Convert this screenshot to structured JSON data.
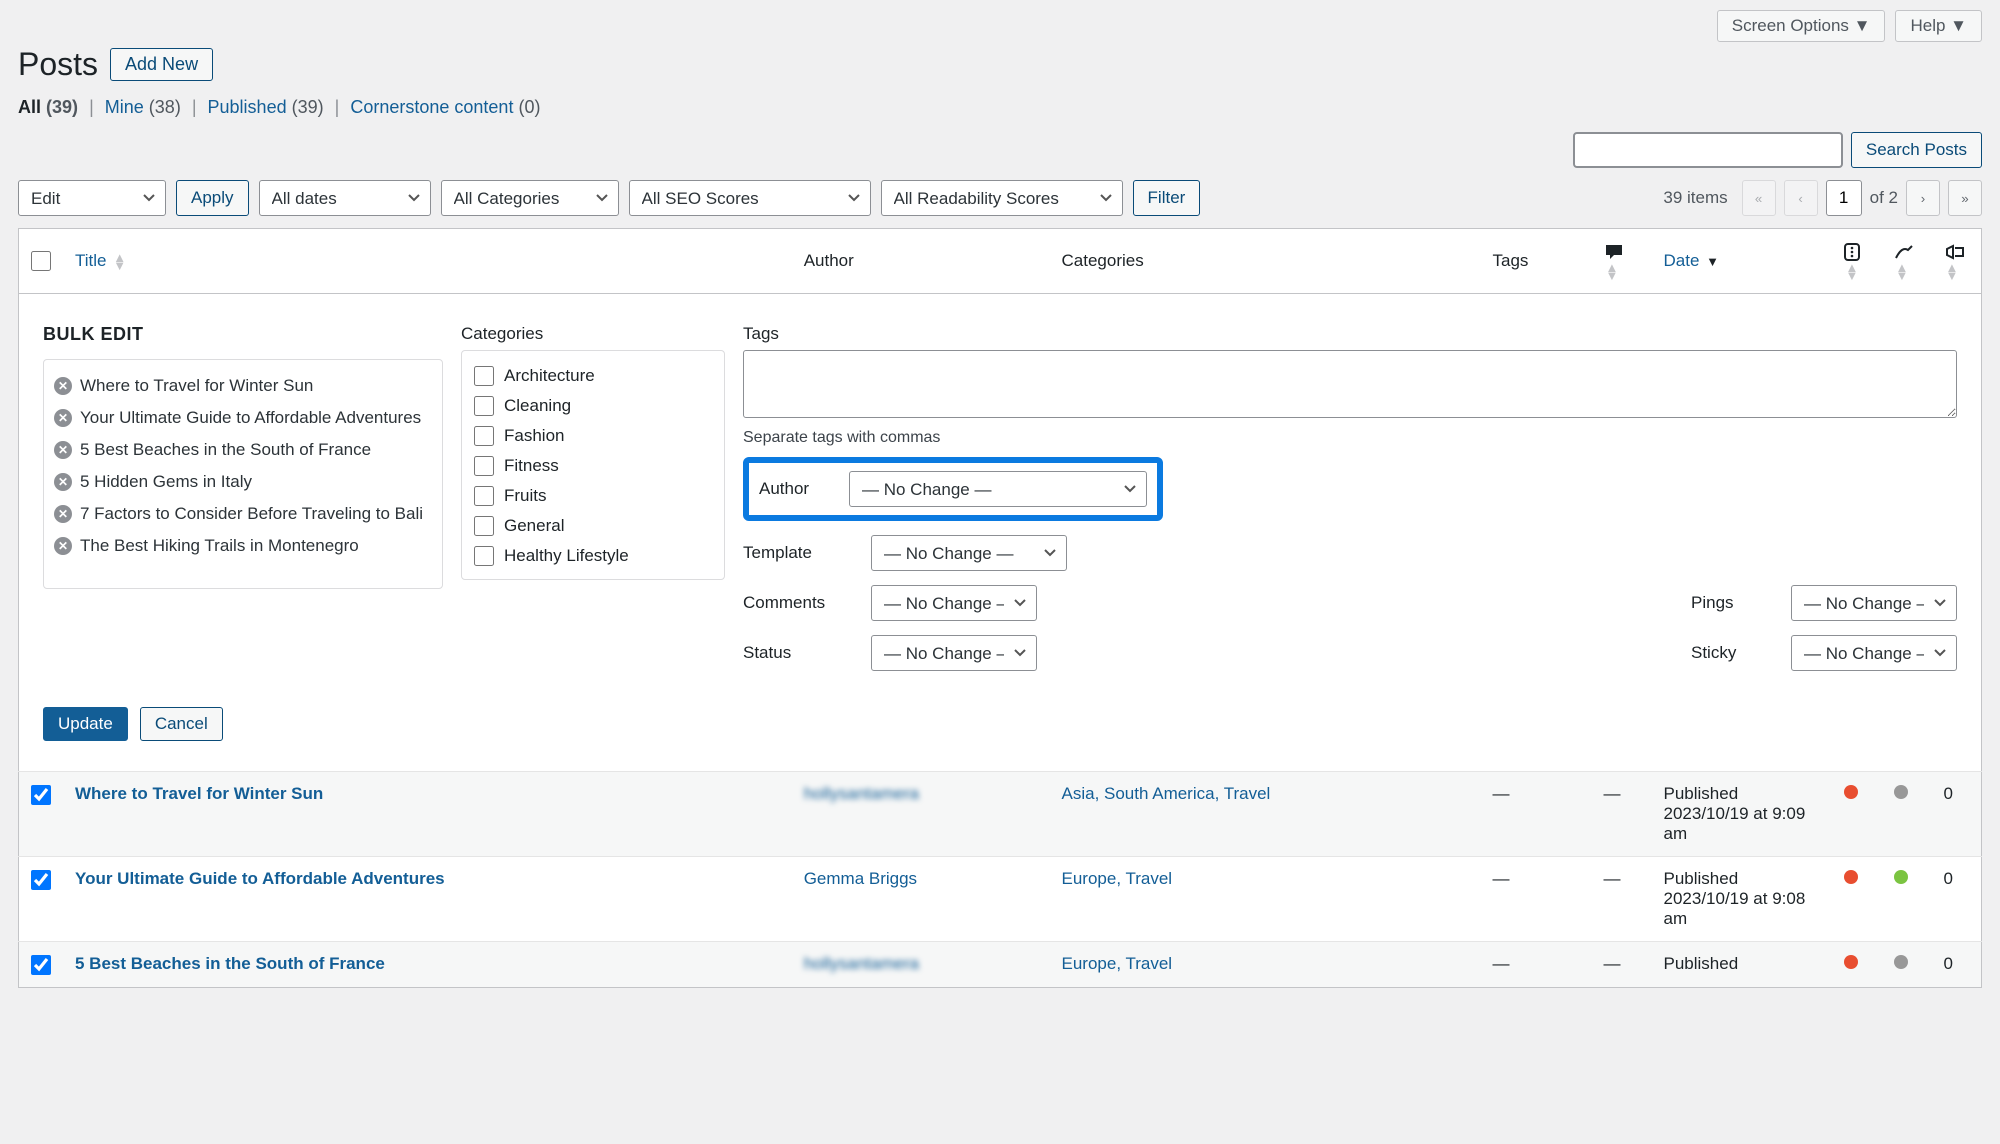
{
  "topbar": {
    "screen_options": "Screen Options ▼",
    "help": "Help ▼"
  },
  "page": {
    "title": "Posts",
    "add_new": "Add New"
  },
  "filters": {
    "all": "All",
    "all_count": "(39)",
    "mine": "Mine",
    "mine_count": "(38)",
    "published": "Published",
    "published_count": "(39)",
    "cornerstone": "Cornerstone content",
    "cornerstone_count": "(0)"
  },
  "bulk_actions": {
    "edit": "Edit",
    "apply": "Apply"
  },
  "dropdowns": {
    "dates": "All dates",
    "categories": "All Categories",
    "seo": "All SEO Scores",
    "readability": "All Readability Scores",
    "filter": "Filter"
  },
  "search": {
    "placeholder": "",
    "button": "Search Posts"
  },
  "pagination": {
    "items": "39 items",
    "current": "1",
    "of": "of 2"
  },
  "columns": {
    "title": "Title",
    "author": "Author",
    "categories": "Categories",
    "tags": "Tags",
    "date": "Date"
  },
  "bulk_edit": {
    "label": "BULK EDIT",
    "cat_label": "Categories",
    "tags_label": "Tags",
    "tags_hint": "Separate tags with commas",
    "posts": [
      "Where to Travel for Winter Sun",
      "Your Ultimate Guide to Affordable Adventures",
      "5 Best Beaches in the South of France",
      "5 Hidden Gems in Italy",
      "7 Factors to Consider Before Traveling to Bali",
      "The Best Hiking Trails in Montenegro"
    ],
    "categories": [
      "Architecture",
      "Cleaning",
      "Fashion",
      "Fitness",
      "Fruits",
      "General",
      "Healthy Lifestyle"
    ],
    "author_lbl": "Author",
    "template_lbl": "Template",
    "comments_lbl": "Comments",
    "status_lbl": "Status",
    "pings_lbl": "Pings",
    "sticky_lbl": "Sticky",
    "no_change": "— No Change —",
    "update": "Update",
    "cancel": "Cancel"
  },
  "rows": [
    {
      "title": "Where to Travel for Winter Sun",
      "author": "hollysantamera",
      "author_blur": true,
      "cats": "Asia, South America, Travel",
      "tags": "—",
      "comments": "—",
      "date_status": "Published",
      "date": "2023/10/19 at 9:09 am",
      "seo": "red",
      "readability": "gray",
      "incoming": "0"
    },
    {
      "title": "Your Ultimate Guide to Affordable Adventures",
      "author": "Gemma Briggs",
      "author_blur": false,
      "cats": "Europe, Travel",
      "tags": "—",
      "comments": "—",
      "date_status": "Published",
      "date": "2023/10/19 at 9:08 am",
      "seo": "red",
      "readability": "green",
      "incoming": "0"
    },
    {
      "title": "5 Best Beaches in the South of France",
      "author": "hollysantamera",
      "author_blur": true,
      "cats": "Europe, Travel",
      "tags": "—",
      "comments": "—",
      "date_status": "Published",
      "date": "",
      "seo": "red",
      "readability": "gray",
      "incoming": "0"
    }
  ]
}
